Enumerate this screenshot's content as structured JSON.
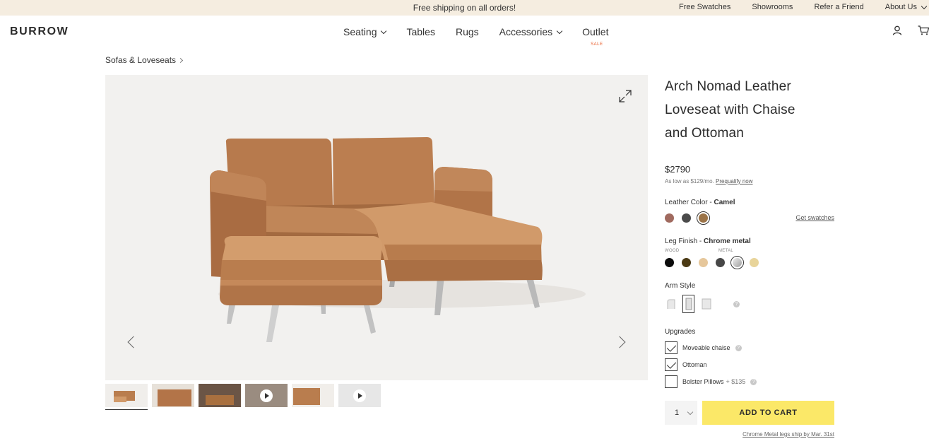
{
  "promo": {
    "message": "Free shipping on all orders!",
    "links": [
      "Free Swatches",
      "Showrooms",
      "Refer a Friend",
      "About Us"
    ]
  },
  "header": {
    "logo": "BURROW",
    "nav": [
      {
        "label": "Seating",
        "dropdown": true
      },
      {
        "label": "Tables",
        "dropdown": false
      },
      {
        "label": "Rugs",
        "dropdown": false
      },
      {
        "label": "Accessories",
        "dropdown": true
      },
      {
        "label": "Outlet",
        "dropdown": false,
        "badge": "SALE"
      }
    ]
  },
  "breadcrumb": "Sofas & Loveseats",
  "product": {
    "title_lines": [
      "Arch Nomad Leather",
      "Loveseat with Chaise",
      "and Ottoman"
    ],
    "price": "$2790",
    "finance_text": "As low as $129/mo.",
    "finance_link": "Prequalify now"
  },
  "leather": {
    "label": "Leather Color - ",
    "selected": "Camel",
    "swatches": [
      "#a06a5f",
      "#4a4a4a",
      "#9b7347"
    ],
    "selected_index": 2,
    "get_swatches": "Get swatches"
  },
  "legs": {
    "label": "Leg Finish - ",
    "selected": "Chrome metal",
    "wood_label": "WOOD",
    "metal_label": "METAL",
    "swatches": [
      "#0b0b0b",
      "#4b3a14",
      "#e6c79b",
      "#474747",
      "#c9c9c9",
      "#e8d49a"
    ],
    "selected_index": 4
  },
  "arm": {
    "label": "Arm Style",
    "help": "?"
  },
  "upgrades": {
    "heading": "Upgrades",
    "items": [
      {
        "label": "Moveable chaise",
        "checked": true,
        "help": "?"
      },
      {
        "label": "Ottoman",
        "checked": true,
        "help": ""
      },
      {
        "label": "Bolster Pillows",
        "price": "+ $135",
        "checked": false,
        "help": "?"
      }
    ]
  },
  "cart": {
    "quantity": "1",
    "button": "ADD TO CART",
    "shipping_note": "Chrome Metal legs ship by Mar. 31st"
  },
  "colors": {
    "promo_bg": "#f5ede0",
    "cart_button": "#fbe868",
    "sale": "#e85c2a",
    "leather": "#b5774a"
  }
}
